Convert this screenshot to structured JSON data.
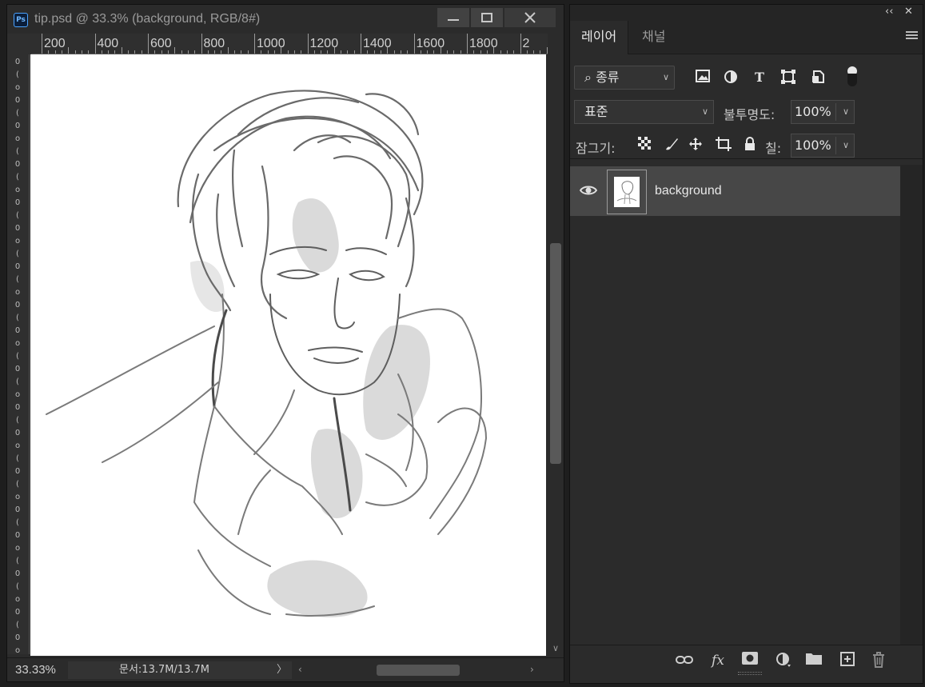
{
  "document": {
    "title": "tip.psd @ 33.3% (background, RGB/8#)",
    "app_icon": "Ps",
    "window_buttons": [
      "minimize",
      "maximize",
      "close"
    ],
    "ruler_labels": [
      "200",
      "400",
      "600",
      "800",
      "1000",
      "1200",
      "1400",
      "1600",
      "1800",
      "2"
    ],
    "zoom": "33.33%",
    "doc_info": "문서:13.7M/13.7M",
    "status_chevron": "〉"
  },
  "layers_panel": {
    "tabs": [
      "레이어",
      "채널"
    ],
    "filter": {
      "label": "종류"
    },
    "blend_mode": "표준",
    "opacity_label": "불투명도:",
    "opacity_value": "100%",
    "lock_label": "잠그기:",
    "fill_label": "칠:",
    "fill_value": "100%",
    "layers": [
      {
        "name": "background",
        "visible": true,
        "selected": true
      }
    ],
    "bottom_icons": [
      "link-icon",
      "fx-icon",
      "mask-icon",
      "adjustment-icon",
      "folder-icon",
      "new-layer-icon",
      "trash-icon"
    ],
    "fx_label": "fx"
  },
  "colors": {
    "app_bg": "#1e1e1e",
    "panel_bg": "#2b2b2b",
    "selected_layer": "#474747",
    "canvas": "#ffffff"
  }
}
